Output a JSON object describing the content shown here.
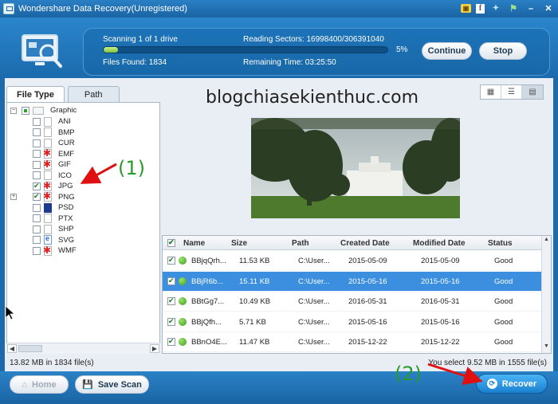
{
  "window": {
    "title": "Wondershare Data Recovery(Unregistered)",
    "minimize": "–",
    "close": "✕"
  },
  "scan": {
    "status": "Scanning 1 of 1 drive",
    "files_found": "Files Found: 1834",
    "reading_sectors": "Reading Sectors: 16998400/306391040",
    "remaining_time": "Remaining Time: 03:25:50",
    "progress_percent_label": "5%",
    "progress": 0.05,
    "continue_label": "Continue",
    "stop_label": "Stop"
  },
  "tabs": [
    {
      "label": "File Type",
      "active": true
    },
    {
      "label": "Path",
      "active": false
    }
  ],
  "tree": {
    "root": "Graphic",
    "items": [
      {
        "label": "ANI",
        "checked": false,
        "icon": "file-icon"
      },
      {
        "label": "BMP",
        "checked": false,
        "icon": "ps-file-icon"
      },
      {
        "label": "CUR",
        "checked": false,
        "icon": "file-icon"
      },
      {
        "label": "EMF",
        "checked": false,
        "icon": "error-file-icon"
      },
      {
        "label": "GIF",
        "checked": false,
        "icon": "error-file-icon"
      },
      {
        "label": "ICO",
        "checked": false,
        "icon": "file-icon"
      },
      {
        "label": "JPG",
        "checked": true,
        "icon": "error-file-icon"
      },
      {
        "label": "PNG",
        "checked": true,
        "icon": "error-file-icon"
      },
      {
        "label": "PSD",
        "checked": false,
        "icon": "ps-file-icon"
      },
      {
        "label": "PTX",
        "checked": false,
        "icon": "file-icon"
      },
      {
        "label": "SHP",
        "checked": false,
        "icon": "file-icon"
      },
      {
        "label": "SVG",
        "checked": false,
        "icon": "ie-file-icon"
      },
      {
        "label": "WMF",
        "checked": false,
        "icon": "error-file-icon"
      }
    ]
  },
  "watermark": "blogchiasekienthuc.com",
  "table": {
    "headers": {
      "name": "Name",
      "size": "Size",
      "path": "Path",
      "created": "Created Date",
      "modified": "Modified Date",
      "status": "Status"
    },
    "rows": [
      {
        "name": "BBjqQrh...",
        "size": "11.53 KB",
        "path": "C:\\User...",
        "created": "2015-05-09",
        "modified": "2015-05-09",
        "status": "Good",
        "selected": false
      },
      {
        "name": "BBjR6b...",
        "size": "15.11 KB",
        "path": "C:\\User...",
        "created": "2015-05-16",
        "modified": "2015-05-16",
        "status": "Good",
        "selected": true
      },
      {
        "name": "BBtGg7...",
        "size": "10.49 KB",
        "path": "C:\\User...",
        "created": "2016-05-31",
        "modified": "2016-05-31",
        "status": "Good",
        "selected": false
      },
      {
        "name": "BBjQfh...",
        "size": "5.71 KB",
        "path": "C:\\User...",
        "created": "2015-05-16",
        "modified": "2015-05-16",
        "status": "Good",
        "selected": false
      },
      {
        "name": "BBnO4E...",
        "size": "11.47 KB",
        "path": "C:\\User...",
        "created": "2015-12-22",
        "modified": "2015-12-22",
        "status": "Good",
        "selected": false
      }
    ]
  },
  "status_left": "13.82 MB in 1834 file(s)",
  "status_right": "You select 9.52 MB in 1555 file(s)",
  "bottom": {
    "home_label": "Home",
    "save_scan_label": "Save Scan",
    "recover_label": "Recover"
  },
  "annotations": {
    "one": "(1)",
    "two": "(2)"
  },
  "colors": {
    "accent": "#1f6aa8",
    "selected_row": "#3b8fde",
    "annotation": "#2a9a2a",
    "arrow": "#e01010"
  }
}
